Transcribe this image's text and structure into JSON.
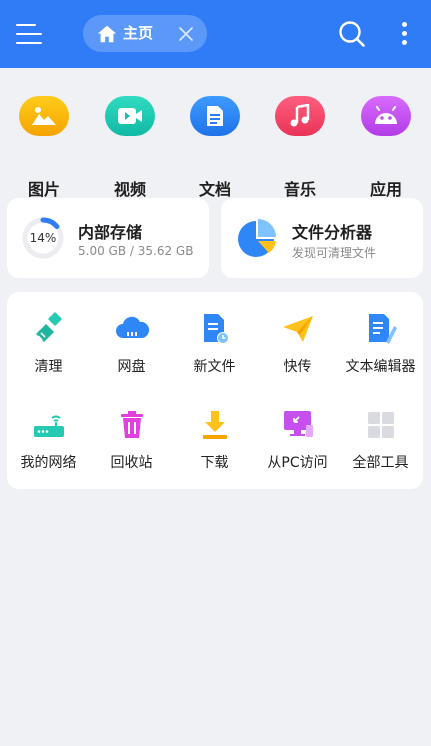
{
  "header": {
    "tab_label": "主页",
    "accent": "#2f7cf6"
  },
  "categories": [
    {
      "label": "图片",
      "icon": "image-icon",
      "color": "#f8b500"
    },
    {
      "label": "视频",
      "icon": "video-icon",
      "color": "#1fc9b0"
    },
    {
      "label": "文档",
      "icon": "document-icon",
      "color": "#2f86f6"
    },
    {
      "label": "音乐",
      "icon": "music-icon",
      "color": "#f0486a"
    },
    {
      "label": "应用",
      "icon": "android-icon",
      "color": "#c64ff0"
    }
  ],
  "storage": {
    "title": "内部存储",
    "usage": "5.00 GB / 35.62 GB",
    "percent_label": "14%",
    "percent": 14
  },
  "analyzer": {
    "title": "文件分析器",
    "subtitle": "发现可清理文件"
  },
  "tools": [
    {
      "label": "清理",
      "icon": "broom-icon"
    },
    {
      "label": "网盘",
      "icon": "cloud-drive-icon"
    },
    {
      "label": "新文件",
      "icon": "new-file-icon"
    },
    {
      "label": "快传",
      "icon": "paper-plane-icon"
    },
    {
      "label": "文本编辑器",
      "icon": "text-editor-icon"
    },
    {
      "label": "我的网络",
      "icon": "router-icon"
    },
    {
      "label": "回收站",
      "icon": "trash-icon"
    },
    {
      "label": "下载",
      "icon": "download-icon"
    },
    {
      "label": "从PC访问",
      "icon": "pc-access-icon"
    },
    {
      "label": "全部工具",
      "icon": "grid-icon"
    }
  ]
}
